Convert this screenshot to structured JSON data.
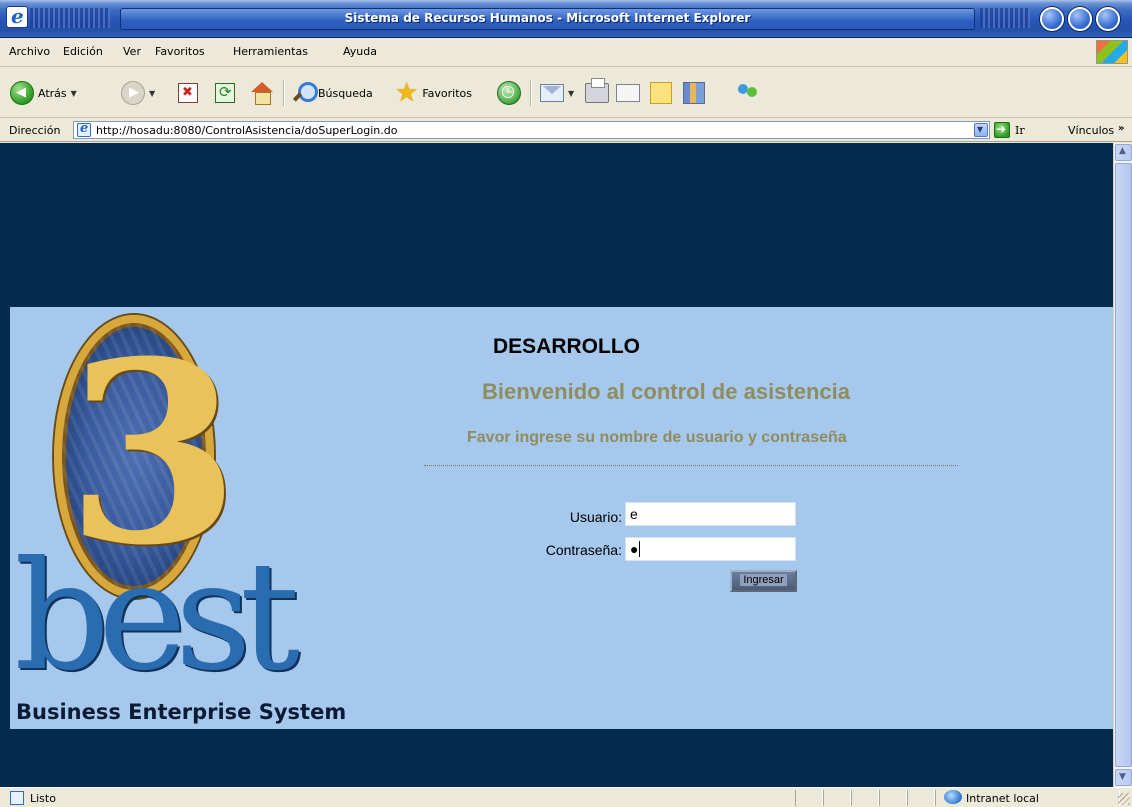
{
  "window": {
    "title": "Sistema de Recursos Humanos - Microsoft Internet Explorer"
  },
  "menu": [
    "Archivo",
    "Edición",
    "Ver",
    "Favoritos",
    "Herramientas",
    "Ayuda"
  ],
  "toolbar": {
    "back_label": "Atrás",
    "search_label": "Búsqueda",
    "favorites_label": "Favoritos"
  },
  "address": {
    "label": "Dirección",
    "url": "http://hosadu:8080/ControlAsistencia/doSuperLogin.do",
    "go_label": "Ir",
    "links_label": "Vínculos"
  },
  "page": {
    "logo_caption": "Business Enterprise System",
    "logo_digit": "3",
    "logo_word": "best",
    "environment": "DESARROLLO",
    "welcome": "Bienvenido al control de asistencia",
    "instructions": "Favor ingrese su nombre de usuario y contraseña",
    "username_label": "Usuario:",
    "username_value": "e",
    "password_label": "Contraseña:",
    "password_mask": "●",
    "submit_label": "Ingresar"
  },
  "status": {
    "text": "Listo",
    "zone": "Intranet local"
  },
  "icons": [
    "app-icon",
    "back-icon",
    "forward-icon",
    "stop-icon",
    "refresh-icon",
    "home-icon",
    "search-icon",
    "favorites-star-icon",
    "history-icon",
    "mail-icon",
    "print-icon",
    "edit-icon",
    "note-icon",
    "research-icon",
    "messenger-icon",
    "go-arrow-icon",
    "windows-logo-icon",
    "intranet-zone-icon"
  ],
  "colors": {
    "page_dark_blue": "#052a4f",
    "band_light_blue": "#a6c8ec",
    "olive_text": "#8f8c5e",
    "titlebar_blue": "#2451a8"
  }
}
